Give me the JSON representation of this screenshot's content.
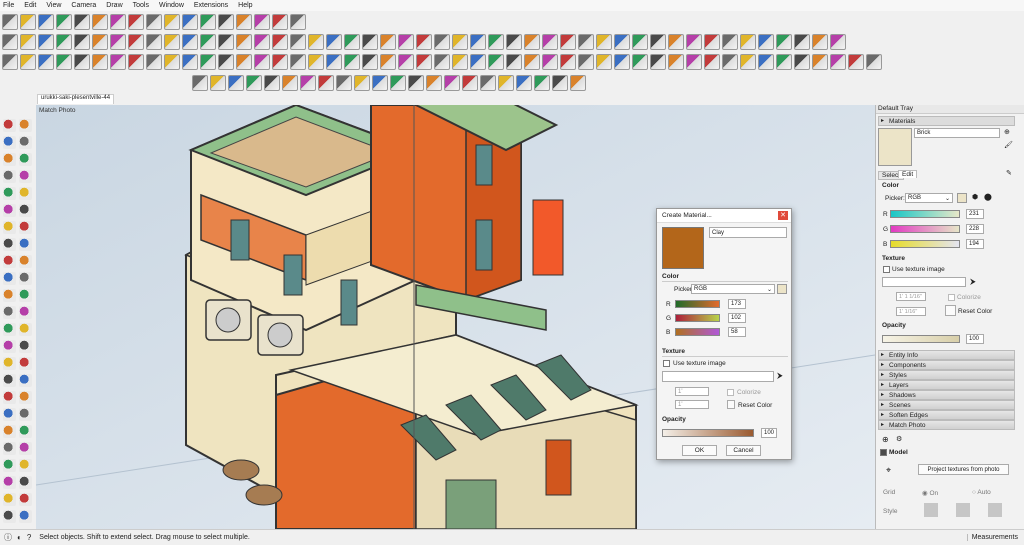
{
  "menu": [
    "File",
    "Edit",
    "View",
    "Camera",
    "Draw",
    "Tools",
    "Window",
    "Extensions",
    "Help"
  ],
  "model_tab": "urukki-saki-plesentville-44",
  "viewport_label": "Match Photo",
  "status": {
    "text": "Select objects. Shift to extend select. Drag mouse to select multiple.",
    "measurements_label": "Measurements"
  },
  "dialog": {
    "title": "Create Material...",
    "name_value": "Clay",
    "swatch_color": "#b3661a",
    "color_label": "Color",
    "picker_label": "Picker:",
    "picker_value": "RGB",
    "r_label": "R",
    "r_value": "173",
    "g_label": "G",
    "g_value": "102",
    "b_label": "B",
    "b_value": "58",
    "texture_label": "Texture",
    "use_texture_label": "Use texture image",
    "tex_w": "1'",
    "tex_h": "1'",
    "colorize_label": "Colorize",
    "reset_color_label": "Reset Color",
    "opacity_label": "Opacity",
    "opacity_value": "100",
    "ok_label": "OK",
    "cancel_label": "Cancel"
  },
  "tray": {
    "title": "Default Tray",
    "materials_header": "Materials",
    "material_name": "Brick",
    "tab_select": "Select",
    "tab_edit": "Edit",
    "color_label": "Color",
    "picker_label": "Picker:",
    "picker_value": "RGB",
    "r_label": "R",
    "r_value": "231",
    "g_label": "G",
    "g_value": "228",
    "b_label": "B",
    "b_value": "194",
    "texture_label": "Texture",
    "use_texture_label": "Use texture image",
    "tex_w": "1' 1 1/16\"",
    "tex_h": "1' 1/16\"",
    "colorize_label": "Colorize",
    "reset_color_label": "Reset Color",
    "opacity_label": "Opacity",
    "opacity_value": "100",
    "panels": [
      "Entity Info",
      "Components",
      "Styles",
      "Layers",
      "Shadows",
      "Scenes",
      "Soften Edges",
      "Match Photo"
    ],
    "model_label": "Model",
    "project_textures_label": "Project textures from photo",
    "grid_label": "Grid",
    "grid_on": "On",
    "grid_auto": "Auto",
    "style_label": "Style"
  },
  "colors": {
    "accent": "#e36a2c",
    "swatch_brick": "#ece4c8"
  }
}
